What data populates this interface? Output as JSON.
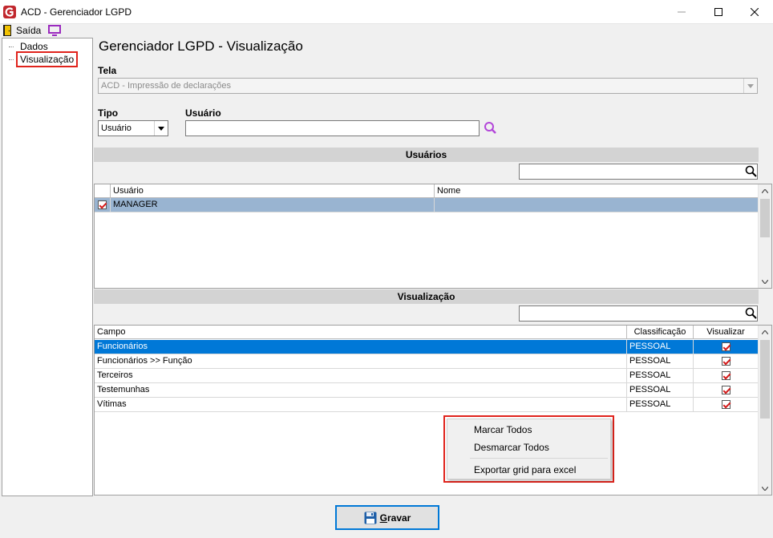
{
  "window": {
    "title": "ACD - Gerenciador LGPD",
    "icons": {
      "app": "app-logo-icon",
      "minimize": "minimize-icon",
      "maximize": "maximize-icon",
      "close": "close-icon"
    }
  },
  "toolbar": {
    "exit_label": "Saída",
    "exit_icon": "door-exit-icon",
    "screen_icon": "monitor-icon"
  },
  "tree": {
    "items": [
      {
        "label": "Dados"
      },
      {
        "label": "Visualização",
        "selected": true
      }
    ]
  },
  "main": {
    "title": "Gerenciador LGPD - Visualização",
    "tela": {
      "label": "Tela",
      "value": "ACD - Impressão de declarações"
    },
    "tipo": {
      "label": "Tipo",
      "value": "Usuário"
    },
    "usuario": {
      "label": "Usuário",
      "value": ""
    }
  },
  "usuarios_section": {
    "title": "Usuários",
    "filter_value": "",
    "columns": [
      "Usuário",
      "Nome"
    ],
    "rows": [
      {
        "checked": true,
        "usuario": "MANAGER",
        "nome": ""
      }
    ]
  },
  "visualizacao_section": {
    "title": "Visualização",
    "filter_value": "",
    "columns": [
      "Campo",
      "Classificação",
      "Visualizar"
    ],
    "rows": [
      {
        "campo": "Funcionários",
        "classificacao": "PESSOAL",
        "visualizar": true,
        "selected": true
      },
      {
        "campo": "Funcionários >> Função",
        "classificacao": "PESSOAL",
        "visualizar": true
      },
      {
        "campo": "Terceiros",
        "classificacao": "PESSOAL",
        "visualizar": true
      },
      {
        "campo": "Testemunhas",
        "classificacao": "PESSOAL",
        "visualizar": true
      },
      {
        "campo": "Vítimas",
        "classificacao": "PESSOAL",
        "visualizar": true
      }
    ]
  },
  "context_menu": {
    "items": [
      "Marcar Todos",
      "Desmarcar Todos",
      "Exportar grid para excel"
    ]
  },
  "footer": {
    "save_prefix": "G",
    "save_rest": "ravar",
    "save_icon": "floppy-disk-icon"
  },
  "colors": {
    "selection": "#0078d7",
    "user_row_selection": "#99b4d1",
    "highlight_border": "#e0231c",
    "section_bar": "#d3d3d3"
  }
}
